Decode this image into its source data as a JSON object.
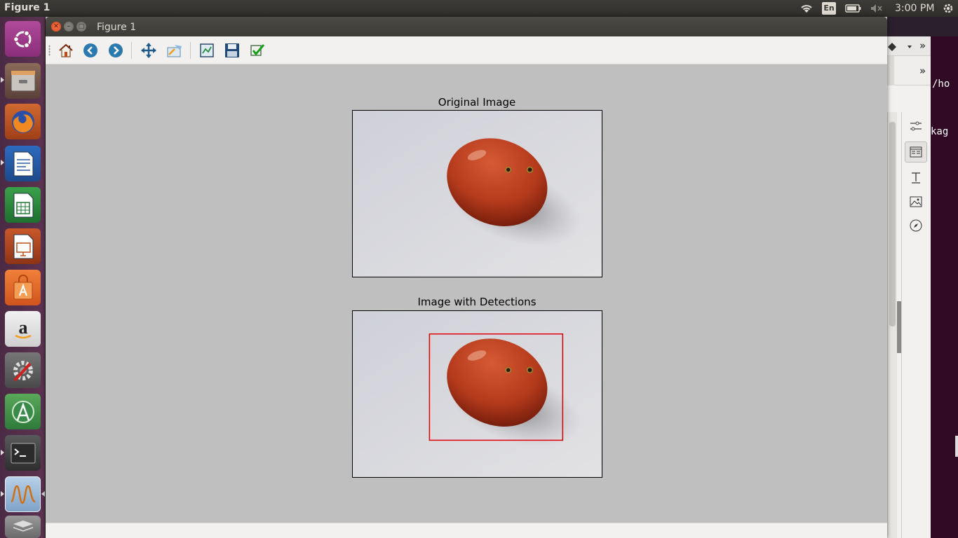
{
  "panel": {
    "app_title": "Figure 1",
    "language": "En",
    "clock": "3:00 PM"
  },
  "window": {
    "title": "Figure 1"
  },
  "toolbar": {
    "buttons": [
      "home-icon",
      "back-arrow-icon",
      "forward-arrow-icon",
      "pan-icon",
      "zoom-icon",
      "subplots-icon",
      "save-icon",
      "check-icon"
    ]
  },
  "figure": {
    "top_title": "Original Image",
    "bottom_title": "Image with Detections",
    "detection_box_color": "#e00000"
  },
  "background": {
    "terminal_line1": "/ho",
    "terminal_line2": "kag",
    "chevron": "»"
  },
  "launcher": {
    "items": [
      "ubuntu-dash-icon",
      "files-icon",
      "firefox-icon",
      "writer-icon",
      "calc-icon",
      "impress-icon",
      "software-center-icon",
      "amazon-icon",
      "settings-icon",
      "android-studio-icon",
      "terminal-icon",
      "oscilloscope-icon",
      "stack-icon"
    ]
  }
}
